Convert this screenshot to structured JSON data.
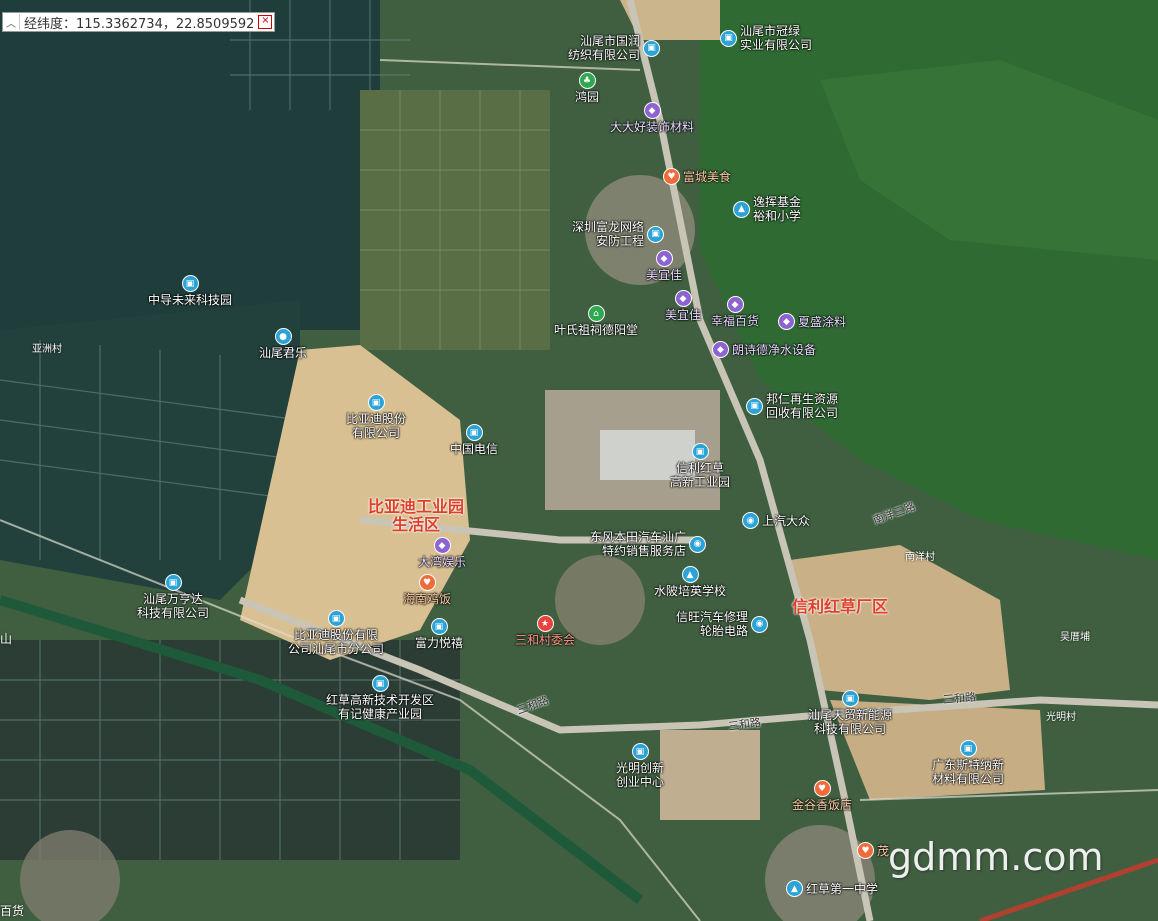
{
  "coord_bar": {
    "collapse_icon": "chevron-up-icon",
    "text": "经纬度：115.3362734，22.8509592",
    "close_label": "×"
  },
  "pois": [
    {
      "name": "汕尾市冠绿\n实业有限公司",
      "color": "blue",
      "icon": "building"
    },
    {
      "name": "汕尾市国润\n纺织有限公司",
      "color": "blue",
      "icon": "building"
    },
    {
      "name": "鸿园",
      "color": "green",
      "icon": "park"
    },
    {
      "name": "大大好装饰材料",
      "color": "purple",
      "icon": "shop"
    },
    {
      "name": "富城美食",
      "color": "orange",
      "icon": "food"
    },
    {
      "name": "逸挥基金\n裕和小学",
      "color": "blue",
      "icon": "school"
    },
    {
      "name": "深圳富龙网络\n安防工程",
      "color": "blue",
      "icon": "building"
    },
    {
      "name": "美宜佳",
      "color": "purple",
      "icon": "shop"
    },
    {
      "name": "美宜佳",
      "color": "purple",
      "icon": "shop"
    },
    {
      "name": "幸福百货",
      "color": "purple",
      "icon": "shop"
    },
    {
      "name": "夏盛涂料",
      "color": "purple",
      "icon": "shop"
    },
    {
      "name": "叶氏祖祠德阳堂",
      "color": "green",
      "icon": "temple"
    },
    {
      "name": "朗诗德净水设备",
      "color": "purple",
      "icon": "shop"
    },
    {
      "name": "中导未来科技园",
      "color": "blue",
      "icon": "building"
    },
    {
      "name": "汕尾君乐",
      "color": "blue",
      "icon": "place"
    },
    {
      "name": "邦仁再生资源\n回收有限公司",
      "color": "blue",
      "icon": "building"
    },
    {
      "name": "比亚迪股份\n有限公司",
      "color": "blue",
      "icon": "building"
    },
    {
      "name": "中国电信",
      "color": "blue",
      "icon": "building"
    },
    {
      "name": "信利红草\n高新工业园",
      "color": "blue",
      "icon": "building"
    },
    {
      "name": "上汽大众",
      "color": "blue",
      "icon": "car"
    },
    {
      "name": "东风本田汽车汕广\n特约销售服务店",
      "color": "blue",
      "icon": "car"
    },
    {
      "name": "大湾娱乐",
      "color": "purple",
      "icon": "shop"
    },
    {
      "name": "水陂培英学校",
      "color": "blue",
      "icon": "school"
    },
    {
      "name": "海南鸡饭",
      "color": "orange",
      "icon": "food"
    },
    {
      "name": "汕尾万亨达\n科技有限公司",
      "color": "blue",
      "icon": "building"
    },
    {
      "name": "信旺汽车修理\n轮胎电路",
      "color": "blue",
      "icon": "car"
    },
    {
      "name": "比亚迪股份有限\n公司汕尾市分公司",
      "color": "blue",
      "icon": "building"
    },
    {
      "name": "富力悦禧",
      "color": "blue",
      "icon": "building"
    },
    {
      "name": "三和村委会",
      "color": "red",
      "icon": "gov"
    },
    {
      "name": "红草高新技术开发区\n有记健康产业园",
      "color": "blue",
      "icon": "building"
    },
    {
      "name": "汕尾天贸新能源\n科技有限公司",
      "color": "blue",
      "icon": "building"
    },
    {
      "name": "光明创新\n创业中心",
      "color": "blue",
      "icon": "building"
    },
    {
      "name": "广东斯特纳新\n材料有限公司",
      "color": "blue",
      "icon": "building"
    },
    {
      "name": "金谷香饭店",
      "color": "orange",
      "icon": "food"
    },
    {
      "name": "茂",
      "color": "orange",
      "icon": "food"
    },
    {
      "name": "红草第一中学",
      "color": "blue",
      "icon": "school"
    }
  ],
  "areas": [
    {
      "name": "比亚迪工业园\n生活区"
    },
    {
      "name": "信利红草厂区"
    }
  ],
  "roads": [
    {
      "name": "三和路"
    },
    {
      "name": "三和路"
    },
    {
      "name": "三和路"
    },
    {
      "name": "南洋三路"
    }
  ],
  "places": [
    {
      "name": "亚洲村"
    },
    {
      "name": "南洋村"
    },
    {
      "name": "吴厝埔"
    },
    {
      "name": "光明村"
    },
    {
      "name": "山"
    },
    {
      "name": "百货"
    }
  ],
  "watermark": "gdmm.com",
  "colors": {
    "poi_blue": "#2ba3d6",
    "poi_purple": "#8c63d0",
    "poi_orange": "#f06a3a",
    "poi_green": "#2fa84f",
    "area_red": "#e0402a"
  }
}
